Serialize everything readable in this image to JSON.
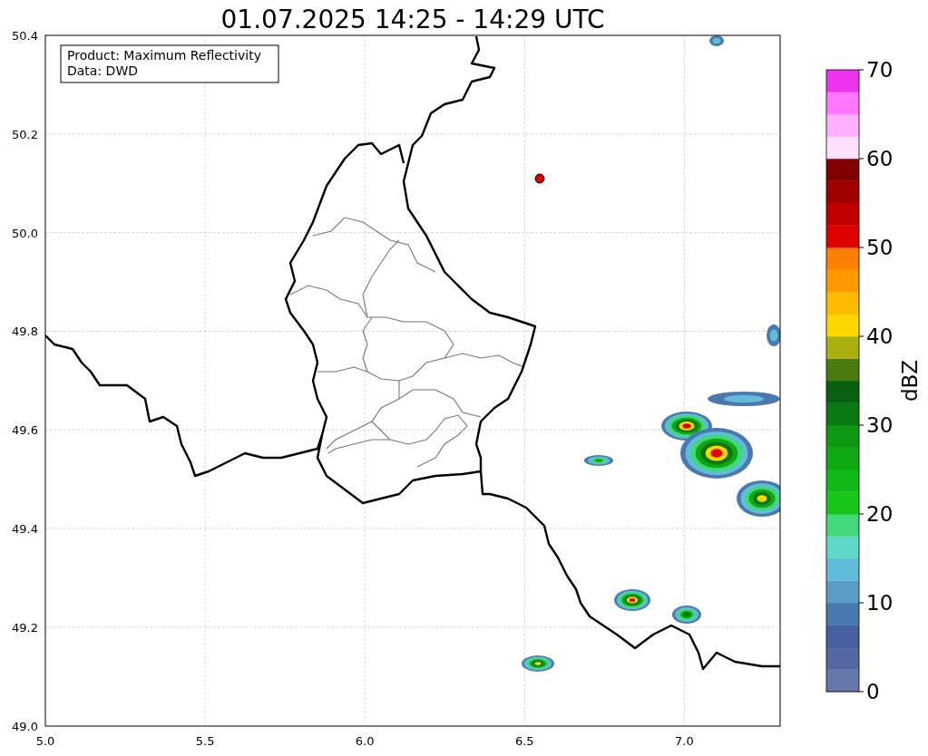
{
  "title": "01.07.2025 14:25 - 14:29 UTC",
  "info_box": {
    "lines": [
      "Product: Maximum Reflectivity",
      "Data: DWD"
    ]
  },
  "map": {
    "xticks": [
      "5.0",
      "5.5",
      "6.0",
      "6.5",
      "7.0"
    ],
    "yticks": [
      "50.4",
      "50.2",
      "50.0",
      "49.8",
      "49.6",
      "49.4",
      "49.2",
      "49.0"
    ]
  },
  "colorbar": {
    "label": "dBZ",
    "ticks": [
      "70",
      "60",
      "50",
      "40",
      "30",
      "20",
      "10",
      "0"
    ],
    "bands": [
      {
        "color": "#6677aa"
      },
      {
        "color": "#5566a5"
      },
      {
        "color": "#4460a0"
      },
      {
        "color": "#4a78b0"
      },
      {
        "color": "#5a9ec8"
      },
      {
        "color": "#60bcd8"
      },
      {
        "color": "#60d8c8"
      },
      {
        "color": "#40d878"
      },
      {
        "color": "#18c818"
      },
      {
        "color": "#10b818"
      },
      {
        "color": "#10a810"
      },
      {
        "color": "#0c9810"
      },
      {
        "color": "#0a7810"
      },
      {
        "color": "#086010"
      },
      {
        "color": "#4a7a10"
      },
      {
        "color": "#aab010"
      },
      {
        "color": "#ffd700"
      },
      {
        "color": "#ffbb00"
      },
      {
        "color": "#ff9900"
      },
      {
        "color": "#ff7f00"
      },
      {
        "color": "#e00000"
      },
      {
        "color": "#c00000"
      },
      {
        "color": "#a00000"
      },
      {
        "color": "#800000"
      },
      {
        "color": "#ffe0ff"
      },
      {
        "color": "#ffb0ff"
      },
      {
        "color": "#ff77ff"
      },
      {
        "color": "#ee33ee"
      }
    ]
  }
}
